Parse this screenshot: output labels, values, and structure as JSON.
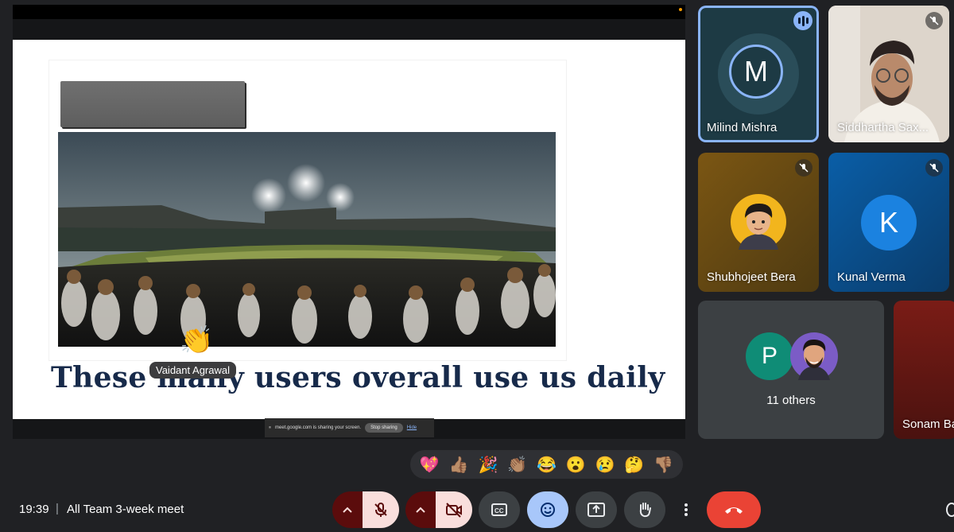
{
  "presentation": {
    "heading": "These many users overall use us daily",
    "presenter_tag": "Vaidant Agrawal",
    "reaction_emoji": "👏",
    "share_banner": {
      "message": "meet.google.com is sharing your screen.",
      "stop_label": "Stop sharing",
      "hide_label": "Hide"
    }
  },
  "participants": [
    {
      "name": "Milind Mishra",
      "initial": "M",
      "speaking": true
    },
    {
      "name": "Siddhartha Sax...",
      "muted": true
    },
    {
      "name": "Shubhojeet Bera",
      "muted": true
    },
    {
      "name": "Kunal Verma",
      "initial": "K",
      "muted": true
    },
    {
      "name": "Sonam Ba"
    }
  ],
  "others": {
    "initial": "P",
    "label": "11 others"
  },
  "reactions": [
    "💖",
    "👍🏽",
    "🎉",
    "👏🏽",
    "😂",
    "😮",
    "😢",
    "🤔",
    "👎🏽"
  ],
  "meeting": {
    "time": "19:39",
    "separator": "|",
    "title": "All Team 3-week meet"
  },
  "colors": {
    "background": "#202124",
    "speaking_border": "#8ab4f8",
    "end_call": "#ea4335",
    "muted_control_bg": "#f9dedc",
    "reactions_active": "#a8c7fa",
    "heading_color": "#172a4a"
  },
  "icons": {
    "mic": "mic-off-icon",
    "camera": "camera-off-icon",
    "captions": "captions-icon",
    "emoji": "emoji-icon",
    "present": "present-icon",
    "hand": "raise-hand-icon",
    "more": "more-vert-icon",
    "end": "call-end-icon"
  }
}
